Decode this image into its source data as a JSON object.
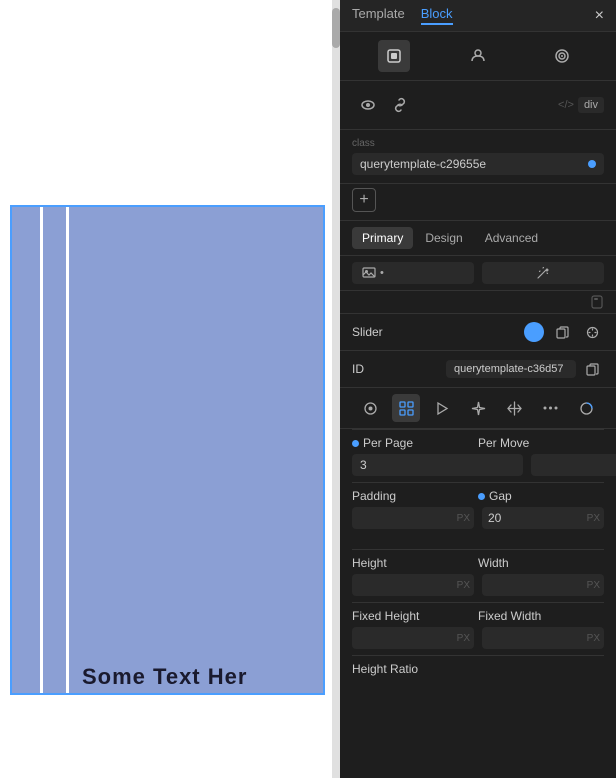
{
  "tabs": {
    "template_label": "Template",
    "block_label": "Block"
  },
  "icons": {
    "cube": "⬡",
    "person": "☺",
    "target": "◎",
    "eye": "👁",
    "link": "🔗",
    "code": "</>",
    "div_tag": "div",
    "close": "×",
    "add": "+",
    "media": "🖼",
    "wand": "✦",
    "scroll": "📜"
  },
  "class_field": {
    "label": "class",
    "value": "querytemplate-c29655e"
  },
  "sub_tabs": {
    "primary": "Primary",
    "design": "Design",
    "advanced": "Advanced"
  },
  "slider": {
    "label": "Slider"
  },
  "id_field": {
    "label": "ID",
    "value": "querytemplate-c36d57"
  },
  "per_page": {
    "label": "Per Page",
    "value": "3"
  },
  "per_move": {
    "label": "Per Move",
    "value": ""
  },
  "padding": {
    "label": "Padding",
    "value": "",
    "unit": "PX"
  },
  "gap": {
    "label": "Gap",
    "value": "20",
    "unit": "PX"
  },
  "height": {
    "label": "Height",
    "value": "",
    "unit": "PX"
  },
  "width": {
    "label": "Width",
    "value": "",
    "unit": "PX"
  },
  "fixed_height": {
    "label": "Fixed Height",
    "value": "",
    "unit": "PX"
  },
  "fixed_width": {
    "label": "Fixed Width",
    "value": "",
    "unit": "PX"
  },
  "height_ratio": {
    "label": "Height Ratio"
  },
  "canvas": {
    "text": "Some Text Her"
  },
  "colors": {
    "accent": "#4a9eff",
    "bg_dark": "#1e1e1e",
    "bg_medium": "#252525",
    "canvas_blue": "#8b9fd4"
  }
}
